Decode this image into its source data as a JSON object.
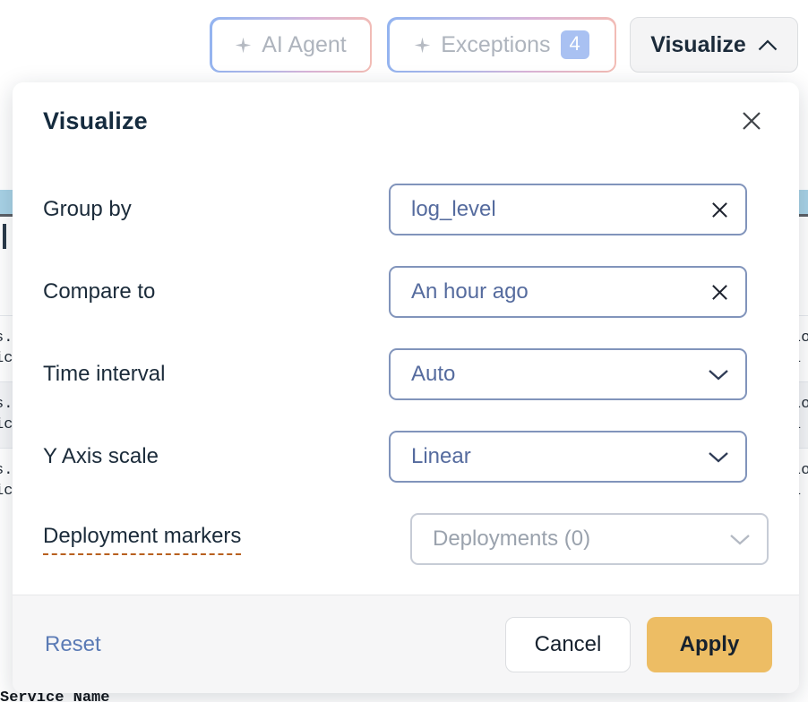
{
  "toolbar": {
    "ai_agent": {
      "label": "AI Agent",
      "icon": "sparkle-icon"
    },
    "exceptions": {
      "label": "Exceptions",
      "count": "4",
      "icon": "sparkle-icon"
    },
    "visualize": {
      "label": "Visualize",
      "icon": "chevron-up-icon"
    }
  },
  "modal": {
    "title": "Visualize",
    "close_icon": "close-icon",
    "rows": [
      {
        "label": "Group by",
        "value": "log_level",
        "control": "combobox",
        "trailing_icon": "clear-icon",
        "disabled": false,
        "hinted": false
      },
      {
        "label": "Compare to",
        "value": "An hour ago",
        "control": "combobox",
        "trailing_icon": "clear-icon",
        "disabled": false,
        "hinted": false
      },
      {
        "label": "Time interval",
        "value": "Auto",
        "control": "select",
        "trailing_icon": "chevron-down-icon",
        "disabled": false,
        "hinted": false
      },
      {
        "label": "Y Axis scale",
        "value": "Linear",
        "control": "select",
        "trailing_icon": "chevron-down-icon",
        "disabled": false,
        "hinted": false
      },
      {
        "label": "Deployment markers",
        "value": "Deployments (0)",
        "control": "select",
        "trailing_icon": "chevron-down-icon",
        "disabled": true,
        "hinted": true
      }
    ],
    "footer": {
      "reset_label": "Reset",
      "cancel_label": "Cancel",
      "apply_label": "Apply"
    }
  },
  "background": {
    "table_rows": [
      {
        "left": "s.\nic",
        "right": "Lo\nl"
      },
      {
        "left": "s.\nic",
        "right": "Lo\nl"
      },
      {
        "left": "s.\nic",
        "right": "Lo\nl"
      }
    ],
    "cut_off_row": "Service Name"
  },
  "colors": {
    "accent_apply": "#edbd64",
    "field_border": "#8194bb",
    "field_text": "#556b9e",
    "title": "#152b3e",
    "hint_underline": "#b8601f",
    "badge": "#a9c1f2",
    "chart_strip": "#a8d2e6"
  }
}
